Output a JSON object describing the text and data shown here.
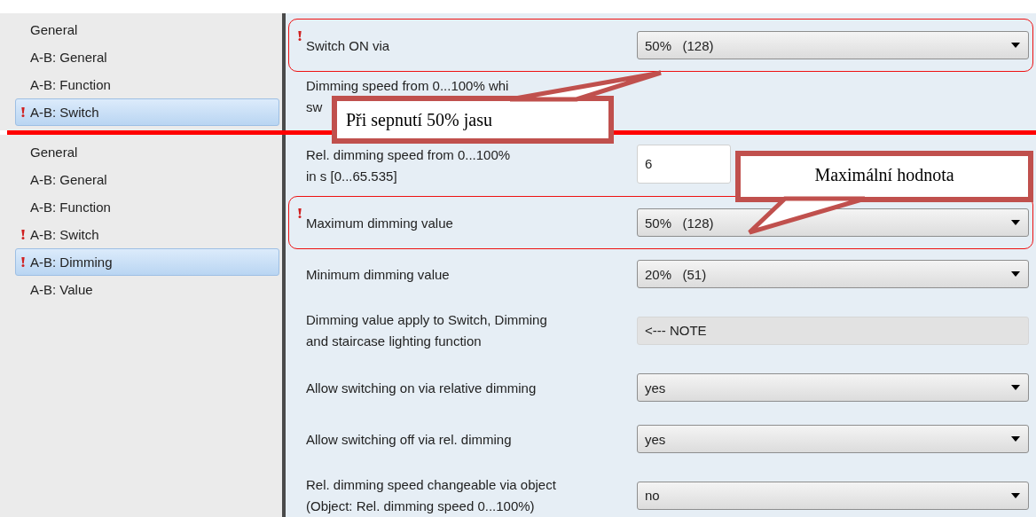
{
  "panels": [
    {
      "sidebar": [
        {
          "label": "General",
          "warning": false,
          "selected": false
        },
        {
          "label": "A-B: General",
          "warning": false,
          "selected": false
        },
        {
          "label": "A-B: Function",
          "warning": false,
          "selected": false
        },
        {
          "label": "A-B: Switch",
          "warning": true,
          "selected": true
        }
      ],
      "rows": [
        {
          "kind": "dropdown",
          "label": [
            "Switch ON via"
          ],
          "value": "50%   (128)",
          "warning": true,
          "highlighted": true
        },
        {
          "kind": "text",
          "label": [
            "Dimming speed from 0...100% whi",
            "sw"
          ],
          "warning": false,
          "highlighted": false
        }
      ]
    },
    {
      "sidebar": [
        {
          "label": "General",
          "warning": false,
          "selected": false
        },
        {
          "label": "A-B: General",
          "warning": false,
          "selected": false
        },
        {
          "label": "A-B: Function",
          "warning": false,
          "selected": false
        },
        {
          "label": "A-B: Switch",
          "warning": true,
          "selected": false
        },
        {
          "label": "A-B: Dimming",
          "warning": true,
          "selected": true
        },
        {
          "label": "A-B: Value",
          "warning": false,
          "selected": false
        }
      ],
      "rows": [
        {
          "kind": "input",
          "label": [
            "Rel. dimming speed from 0...100%",
            "in s [0...65.535]"
          ],
          "value": "6",
          "warning": false,
          "highlighted": false
        },
        {
          "kind": "dropdown",
          "label": [
            "Maximum dimming value"
          ],
          "value": "50%   (128)",
          "warning": true,
          "highlighted": true
        },
        {
          "kind": "dropdown",
          "label": [
            "Minimum dimming value"
          ],
          "value": "20%   (51)",
          "warning": false,
          "highlighted": false
        },
        {
          "kind": "note",
          "label": [
            "Dimming value apply to Switch, Dimming",
            "and staircase lighting function"
          ],
          "value": "<--- NOTE",
          "warning": false,
          "highlighted": false
        },
        {
          "kind": "dropdown",
          "label": [
            "Allow switching on via relative dimming"
          ],
          "value": "yes",
          "warning": false,
          "highlighted": false
        },
        {
          "kind": "dropdown",
          "label": [
            "Allow switching off via rel. dimming"
          ],
          "value": "yes",
          "warning": false,
          "highlighted": false
        },
        {
          "kind": "dropdown",
          "label": [
            "Rel. dimming speed changeable via object",
            "(Object: Rel. dimming speed 0...100%)"
          ],
          "value": "no",
          "warning": false,
          "highlighted": false
        }
      ]
    }
  ],
  "callouts": [
    {
      "text": "Při sepnutí 50% jasu"
    },
    {
      "text": "Maximální hodnota"
    }
  ]
}
